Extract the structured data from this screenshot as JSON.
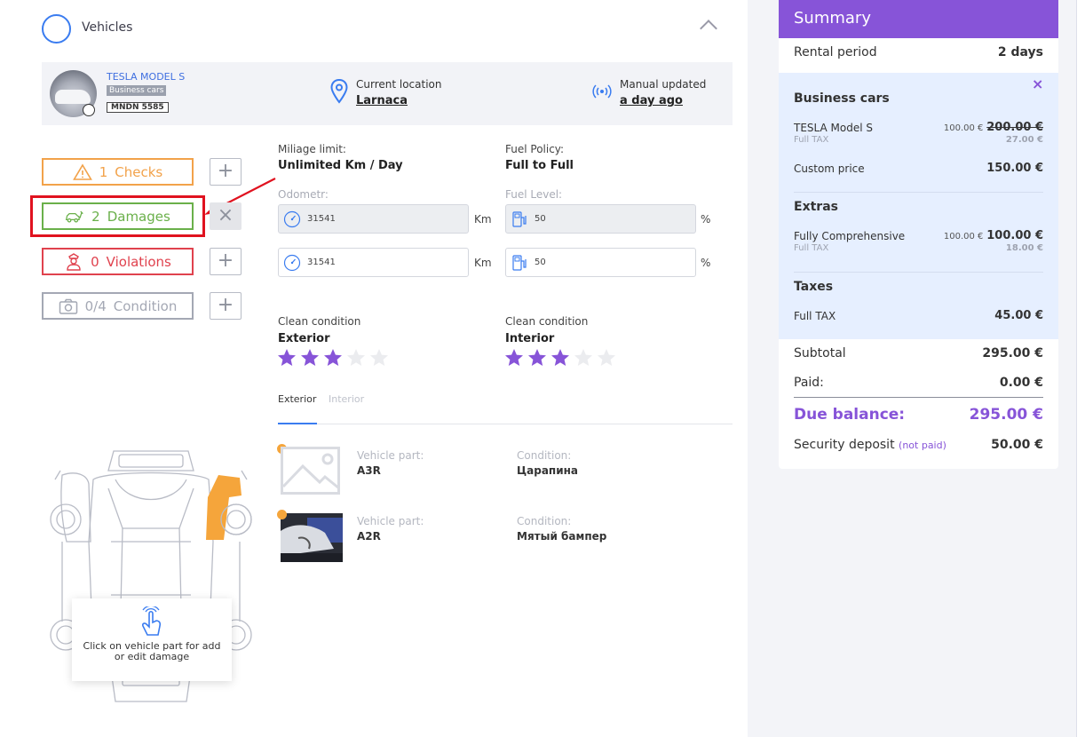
{
  "vehicles": {
    "title": "Vehicles",
    "car": {
      "name": "TESLA MODEL S",
      "category": "Business cars",
      "plate": "MNDN 5585",
      "location_label": "Current location",
      "location_value": "Larnaca",
      "updated_label": "Manual updated",
      "updated_value": "a day ago"
    },
    "status_buttons": {
      "checks": {
        "count": "1",
        "label": "Checks"
      },
      "damages": {
        "count": "2",
        "label": "Damages"
      },
      "violations": {
        "count": "0",
        "label": "Violations"
      },
      "condition": {
        "count": "0/4",
        "label": "Condition"
      }
    },
    "side_plus": "+",
    "side_close": "×",
    "mileage_label": "Miliage limit:",
    "mileage_value": "Unlimited Km / Day",
    "fuel_policy_label": "Fuel Policy:",
    "fuel_policy_value": "Full to Full",
    "odometer_label": "Odometr:",
    "fuel_level_label": "Fuel Level:",
    "odometer_1": "31541",
    "odometer_2": "31541",
    "fuel_1": "50",
    "fuel_2": "50",
    "km_unit": "Km",
    "pct_unit": "%",
    "clean_label": "Clean condition",
    "exterior_title": "Exterior",
    "interior_title": "Interior",
    "exterior_rating": 3,
    "interior_rating": 3,
    "rating_max": 5,
    "tabs": [
      "Exterior",
      "Interior"
    ],
    "damages": [
      {
        "part_label": "Vehicle part:",
        "part": "A3R",
        "condition_label": "Condition:",
        "condition": "Царапина"
      },
      {
        "part_label": "Vehicle part:",
        "part": "A2R",
        "condition_label": "Condition:",
        "condition": "Мятый бампер"
      }
    ],
    "hint": "Click on vehicle part for add or edit damage"
  },
  "summary": {
    "title": "Summary",
    "rental_period_label": "Rental period",
    "rental_period_value": "2 days",
    "business_cars_heading": "Business cars",
    "tesla_label": "TESLA Model S",
    "tesla_tax": "Full TAX",
    "tesla_price_small": "100.00 €",
    "tesla_price_struck": "200.00 €",
    "tesla_tax_value": "27.00 €",
    "custom_price_label": "Custom price",
    "custom_price_value": "150.00 €",
    "extras_heading": "Extras",
    "extra_label": "Fully Comprehensive",
    "extra_tax": "Full TAX",
    "extra_price_small": "100.00 €",
    "extra_price": "100.00 €",
    "extra_tax_value": "18.00 €",
    "taxes_heading": "Taxes",
    "tax_label": "Full TAX",
    "tax_value": "45.00 €",
    "subtotal_label": "Subtotal",
    "subtotal_value": "295.00 €",
    "paid_label": "Paid:",
    "paid_value": "0.00 €",
    "due_label": "Due balance:",
    "due_value": "295.00 €",
    "deposit_label": "Security deposit",
    "deposit_note": "(not paid)",
    "deposit_value": "50.00 €",
    "close": "×"
  },
  "colors": {
    "accent": "#8754d8",
    "link": "#3f6fe0",
    "checks": "#f2a24a",
    "damages": "#6ab04a",
    "violations": "#e0424e",
    "condition": "#a4a8b4",
    "highlight": "#e0121f",
    "damaged_part": "#f5a53b"
  }
}
